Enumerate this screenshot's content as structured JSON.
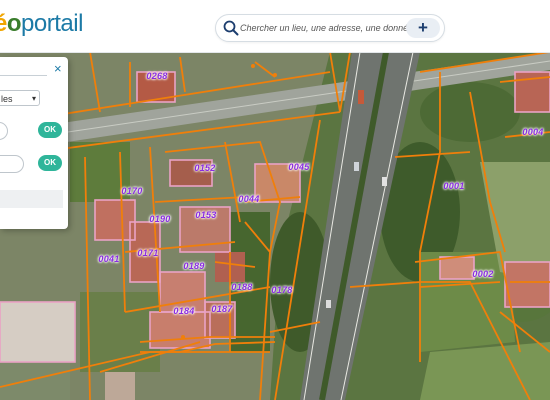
{
  "header": {
    "logo_part1": "é",
    "logo_part2": "o",
    "logo_part3": "portail",
    "search_placeholder": "Chercher un lieu, une adresse, une donnée",
    "add_label": "+"
  },
  "panel": {
    "close_label": "×",
    "select_value": "les",
    "ok_label_1": "OK",
    "ok_label_2": "OK"
  },
  "map": {
    "parcels": [
      {
        "label": "0268"
      },
      {
        "label": "0152"
      },
      {
        "label": "0045"
      },
      {
        "label": "0170"
      },
      {
        "label": "0044"
      },
      {
        "label": "0153"
      },
      {
        "label": "0190"
      },
      {
        "label": "0171"
      },
      {
        "label": "0041"
      },
      {
        "label": "0189"
      },
      {
        "label": "0188"
      },
      {
        "label": "0178"
      },
      {
        "label": "0184"
      },
      {
        "label": "0187"
      },
      {
        "label": "0001"
      },
      {
        "label": "0004"
      },
      {
        "label": "0002"
      }
    ],
    "colors": {
      "boundary": "#f07f0a",
      "label": "#8a2be2",
      "building": "#e9a2c5"
    }
  }
}
